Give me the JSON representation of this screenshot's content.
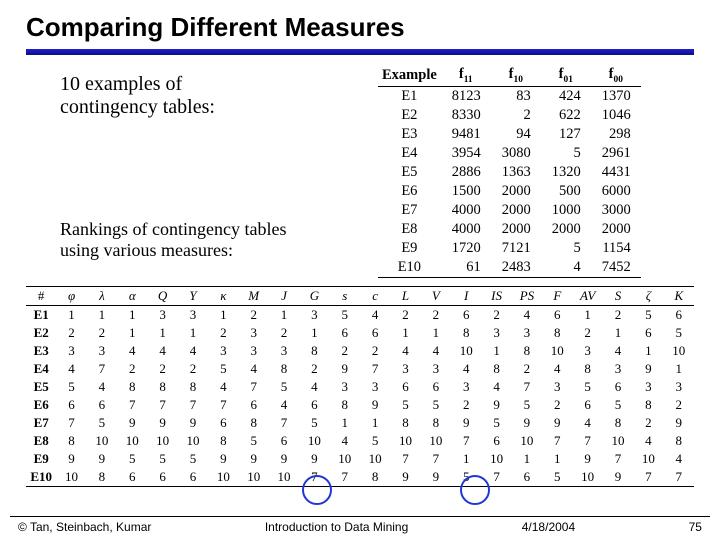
{
  "slide": {
    "title": "Comparing Different Measures",
    "lead_line1": "10 examples of",
    "lead_line2": "contingency tables:",
    "rank_line1": "Rankings of contingency tables",
    "rank_line2": "using various measures:"
  },
  "ct": {
    "headers": {
      "c0": "Example",
      "c1": "f",
      "s1": "11",
      "c2": "f",
      "s2": "10",
      "c3": "f",
      "s3": "01",
      "c4": "f",
      "s4": "00"
    },
    "rows": [
      {
        "e": "E1",
        "a": "8123",
        "b": "83",
        "c": "424",
        "d": "1370"
      },
      {
        "e": "E2",
        "a": "8330",
        "b": "2",
        "c": "622",
        "d": "1046"
      },
      {
        "e": "E3",
        "a": "9481",
        "b": "94",
        "c": "127",
        "d": "298"
      },
      {
        "e": "E4",
        "a": "3954",
        "b": "3080",
        "c": "5",
        "d": "2961"
      },
      {
        "e": "E5",
        "a": "2886",
        "b": "1363",
        "c": "1320",
        "d": "4431"
      },
      {
        "e": "E6",
        "a": "1500",
        "b": "2000",
        "c": "500",
        "d": "6000"
      },
      {
        "e": "E7",
        "a": "4000",
        "b": "2000",
        "c": "1000",
        "d": "3000"
      },
      {
        "e": "E8",
        "a": "4000",
        "b": "2000",
        "c": "2000",
        "d": "2000"
      },
      {
        "e": "E9",
        "a": "1720",
        "b": "7121",
        "c": "5",
        "d": "1154"
      },
      {
        "e": "E10",
        "a": "61",
        "b": "2483",
        "c": "4",
        "d": "7452"
      }
    ]
  },
  "rank": {
    "headers": [
      "#",
      "φ",
      "λ",
      "α",
      "Q",
      "Y",
      "κ",
      "M",
      "J",
      "G",
      "s",
      "c",
      "L",
      "V",
      "I",
      "IS",
      "PS",
      "F",
      "AV",
      "S",
      "ζ",
      "K"
    ],
    "rows": [
      [
        "E1",
        "1",
        "1",
        "1",
        "3",
        "3",
        "1",
        "2",
        "1",
        "3",
        "5",
        "4",
        "2",
        "2",
        "6",
        "2",
        "4",
        "6",
        "1",
        "2",
        "5",
        "6"
      ],
      [
        "E2",
        "2",
        "2",
        "1",
        "1",
        "1",
        "2",
        "3",
        "2",
        "1",
        "6",
        "6",
        "1",
        "1",
        "8",
        "3",
        "3",
        "8",
        "2",
        "1",
        "6",
        "5"
      ],
      [
        "E3",
        "3",
        "3",
        "4",
        "4",
        "4",
        "3",
        "3",
        "3",
        "8",
        "2",
        "2",
        "4",
        "4",
        "10",
        "1",
        "8",
        "10",
        "3",
        "4",
        "1",
        "10"
      ],
      [
        "E4",
        "4",
        "7",
        "2",
        "2",
        "2",
        "5",
        "4",
        "8",
        "2",
        "9",
        "7",
        "3",
        "3",
        "4",
        "8",
        "2",
        "4",
        "8",
        "3",
        "9",
        "1"
      ],
      [
        "E5",
        "5",
        "4",
        "8",
        "8",
        "8",
        "4",
        "7",
        "5",
        "4",
        "3",
        "3",
        "6",
        "6",
        "3",
        "4",
        "7",
        "3",
        "5",
        "6",
        "3",
        "3"
      ],
      [
        "E6",
        "6",
        "6",
        "7",
        "7",
        "7",
        "7",
        "6",
        "4",
        "6",
        "8",
        "9",
        "5",
        "5",
        "2",
        "9",
        "5",
        "2",
        "6",
        "5",
        "8",
        "2"
      ],
      [
        "E7",
        "7",
        "5",
        "9",
        "9",
        "9",
        "6",
        "8",
        "7",
        "5",
        "1",
        "1",
        "8",
        "8",
        "9",
        "5",
        "9",
        "9",
        "4",
        "8",
        "2",
        "9"
      ],
      [
        "E8",
        "8",
        "10",
        "10",
        "10",
        "10",
        "8",
        "5",
        "6",
        "10",
        "4",
        "5",
        "10",
        "10",
        "7",
        "6",
        "10",
        "7",
        "7",
        "10",
        "4",
        "8"
      ],
      [
        "E9",
        "9",
        "9",
        "5",
        "5",
        "5",
        "9",
        "9",
        "9",
        "9",
        "10",
        "10",
        "7",
        "7",
        "1",
        "10",
        "1",
        "1",
        "9",
        "7",
        "10",
        "4"
      ],
      [
        "E10",
        "10",
        "8",
        "6",
        "6",
        "6",
        "10",
        "10",
        "10",
        "7",
        "7",
        "8",
        "9",
        "9",
        "5",
        "7",
        "6",
        "5",
        "10",
        "9",
        "7",
        "7"
      ]
    ]
  },
  "footer": {
    "left": "© Tan, Steinbach, Kumar",
    "center": "Introduction to Data Mining",
    "date": "4/18/2004",
    "page": "75"
  }
}
